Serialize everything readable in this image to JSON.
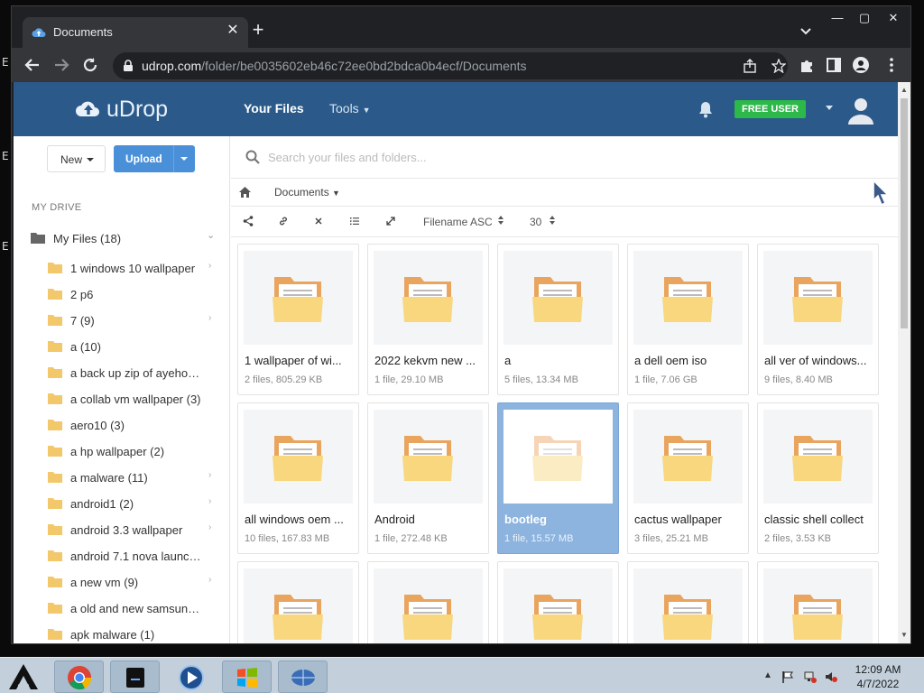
{
  "desktop": {
    "left_letters": [
      "E",
      "E",
      "E"
    ]
  },
  "browser": {
    "tab_title": "Documents",
    "url_host": "udrop.com",
    "url_path": "/folder/be0035602eb46c72ee0bd2bdca0b4ecf/Documents"
  },
  "header": {
    "logo_text": "uDrop",
    "nav_your_files": "Your Files",
    "nav_tools": "Tools",
    "badge": "FREE USER"
  },
  "sidebar": {
    "new_label": "New",
    "upload_label": "Upload",
    "section_label": "MY DRIVE",
    "root_label": "My Files (18)",
    "items": [
      {
        "label": "1 windows 10 wallpaper",
        "expandable": true
      },
      {
        "label": "2 p6",
        "expandable": false
      },
      {
        "label": "7 (9)",
        "expandable": true
      },
      {
        "label": "a (10)",
        "expandable": false
      },
      {
        "label": "a back up zip of ayehosting",
        "expandable": false
      },
      {
        "label": "a collab vm wallpaper (3)",
        "expandable": false
      },
      {
        "label": "aero10 (3)",
        "expandable": false
      },
      {
        "label": "a hp wallpaper (2)",
        "expandable": false
      },
      {
        "label": "a malware (11)",
        "expandable": true
      },
      {
        "label": "android1 (2)",
        "expandable": true
      },
      {
        "label": "android 3.3 wallpaper",
        "expandable": true
      },
      {
        "label": "android 7.1 nova launcher",
        "expandable": false
      },
      {
        "label": "a new vm (9)",
        "expandable": true
      },
      {
        "label": "a old and new samsung d",
        "expandable": false
      },
      {
        "label": "apk malware (1)",
        "expandable": false
      }
    ]
  },
  "main": {
    "search_placeholder": "Search your files and folders...",
    "breadcrumb": "Documents",
    "sort_label": "Filename ASC",
    "per_page": "30",
    "cards": [
      {
        "name": "1 wallpaper of wi...",
        "meta": "2 files, 805.29 KB",
        "selected": false
      },
      {
        "name": "2022 kekvm new ...",
        "meta": "1 file, 29.10 MB",
        "selected": false
      },
      {
        "name": "a",
        "meta": "5 files, 13.34 MB",
        "selected": false
      },
      {
        "name": "a dell oem iso",
        "meta": "1 file, 7.06 GB",
        "selected": false
      },
      {
        "name": "all ver of windows...",
        "meta": "9 files, 8.40 MB",
        "selected": false
      },
      {
        "name": "all windows oem ...",
        "meta": "10 files, 167.83 MB",
        "selected": false
      },
      {
        "name": "Android",
        "meta": "1 file, 272.48 KB",
        "selected": false
      },
      {
        "name": "bootleg",
        "meta": "1 file, 15.57 MB",
        "selected": true
      },
      {
        "name": "cactus wallpaper",
        "meta": "3 files, 25.21 MB",
        "selected": false
      },
      {
        "name": "classic shell collect",
        "meta": "2 files, 3.53 KB",
        "selected": false
      },
      {
        "name": "",
        "meta": "",
        "selected": false
      },
      {
        "name": "",
        "meta": "",
        "selected": false
      },
      {
        "name": "",
        "meta": "",
        "selected": false
      },
      {
        "name": "",
        "meta": "",
        "selected": false
      },
      {
        "name": "",
        "meta": "",
        "selected": false
      }
    ]
  },
  "taskbar": {
    "time": "12:09 AM",
    "date": "4/7/2022"
  },
  "colors": {
    "header_bg": "#2b5a8a",
    "badge_green": "#2db84a",
    "upload_blue": "#4a90d9",
    "selected_card": "#8db4df",
    "folder_yellow": "#f9d77e",
    "folder_orange": "#e9a45e"
  }
}
